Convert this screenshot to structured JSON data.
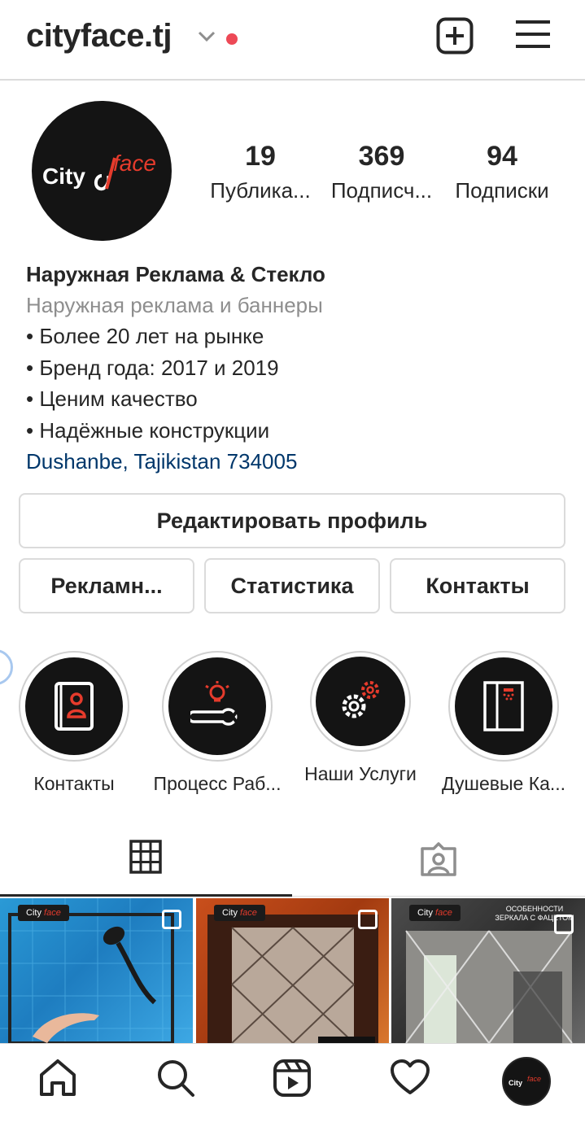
{
  "header": {
    "username": "cityface.tj",
    "icons": {
      "dropdown": "chevron-down-icon",
      "notification": "red-dot-icon",
      "add": "plus-square-icon",
      "menu": "hamburger-menu-icon"
    }
  },
  "profile": {
    "avatar_text_city": "City",
    "avatar_text_face": "face",
    "stats": [
      {
        "value": "19",
        "label": "Публика..."
      },
      {
        "value": "369",
        "label": "Подписч..."
      },
      {
        "value": "94",
        "label": "Подписки"
      }
    ],
    "bio": {
      "name": "Наружная Реклама & Стекло",
      "category": "Наружная реклама и баннеры",
      "lines": [
        "• Более 20 лет на рынке",
        "• Бренд года: 2017 и 2019",
        "• Ценим качество",
        "• Надёжные конструкции"
      ],
      "location": "Dushanbe, Tajikistan 734005"
    }
  },
  "buttons": {
    "edit_profile": "Редактировать профиль",
    "ads": "Рекламн...",
    "stats": "Статистика",
    "contacts": "Контакты"
  },
  "highlights": [
    {
      "label": "Контакты",
      "icon": "contact-book-icon"
    },
    {
      "label": "Процесс Раб...",
      "icon": "idea-wrench-icon"
    },
    {
      "label": "Наши Услуги",
      "icon": "gears-icon"
    },
    {
      "label": "Душевые Ка...",
      "icon": "shower-cabin-icon"
    }
  ],
  "tabs": [
    {
      "name": "grid",
      "icon": "grid-icon",
      "active": true
    },
    {
      "name": "tagged",
      "icon": "tagged-person-icon",
      "active": false
    }
  ],
  "posts": [
    {
      "brand_city": "City",
      "brand_face": "face",
      "caption": ""
    },
    {
      "brand_city": "City",
      "brand_face": "face",
      "caption": ""
    },
    {
      "brand_city": "City",
      "brand_face": "face",
      "caption": "ОСОБЕННОСТИ ЗЕРКАЛА С ФАЦЕТОМ"
    }
  ],
  "bottom_nav": [
    {
      "name": "home",
      "icon": "home-icon"
    },
    {
      "name": "search",
      "icon": "search-icon"
    },
    {
      "name": "reels",
      "icon": "reels-icon"
    },
    {
      "name": "activity",
      "icon": "heart-icon"
    },
    {
      "name": "profile",
      "icon": "profile-avatar-icon"
    }
  ],
  "colors": {
    "text": "#262626",
    "muted": "#8e8e8e",
    "link": "#00376b",
    "accent_red": "#ed4956",
    "brand_red": "#e53b2c",
    "border": "#dbdbdb"
  }
}
